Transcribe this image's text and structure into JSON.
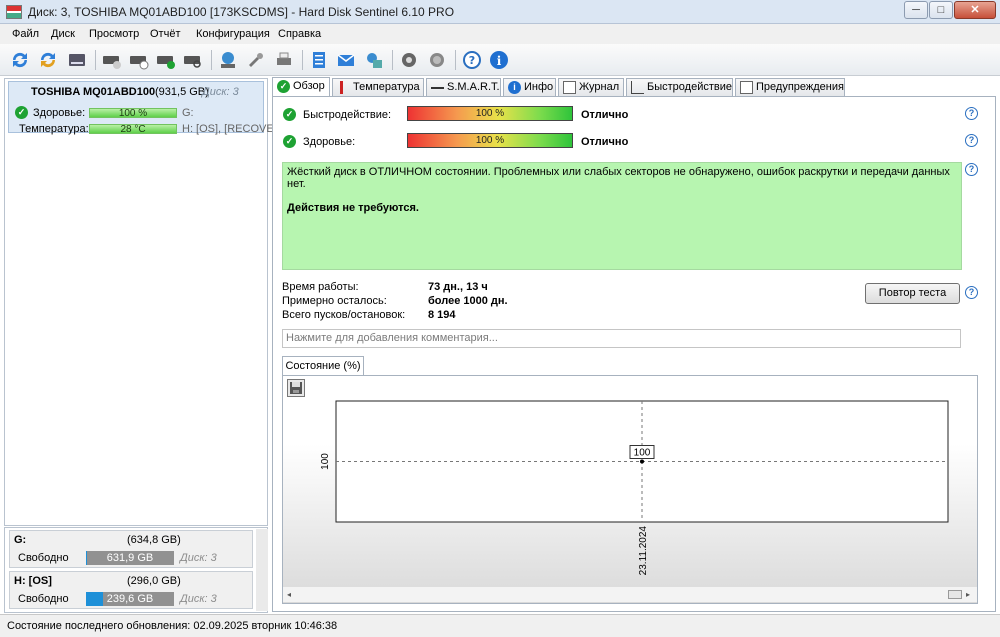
{
  "window": {
    "title": "Диск: 3, TOSHIBA MQ01ABD100 [173KSCDMS]  -  Hard Disk Sentinel 6.10 PRO",
    "minimize": "─",
    "maximize": "□",
    "close": "✕"
  },
  "menu": [
    "Файл",
    "Диск",
    "Просмотр",
    "Отчёт",
    "Конфигурация",
    "Справка"
  ],
  "toolbar_icons": [
    "refresh-icon",
    "refresh-all-icon",
    "disk-icon",
    "disk-info-icon",
    "disk-test-icon",
    "disk-ok-icon",
    "disk-search-icon",
    "network-icon",
    "tools-icon",
    "printer-icon",
    "report-icon",
    "mail-icon",
    "send-icon",
    "settings-icon",
    "sound-icon",
    "help-icon",
    "info-icon"
  ],
  "disk": {
    "name": "TOSHIBA MQ01ABD100",
    "size": "(931,5 GB)",
    "number": "Диск: 3",
    "health_label": "Здоровье:",
    "health_value": "100 %",
    "health_drive": "G:",
    "temp_label": "Температура:",
    "temp_value": "28 °C",
    "temp_drives": "H: [OS],  [RECOVER"
  },
  "partitions": [
    {
      "name": "G:",
      "size": "(634,8 GB)",
      "free_label": "Свободно",
      "free": "631,9 GB",
      "free_fraction": 0.995,
      "disk": "Диск: 3"
    },
    {
      "name": "H: [OS]",
      "size": "(296,0 GB)",
      "free_label": "Свободно",
      "free": "239,6 GB",
      "free_fraction": 0.81,
      "disk": "Диск: 3"
    }
  ],
  "tabs": [
    {
      "label": "Обзор",
      "icon": "check-icon"
    },
    {
      "label": "Температура",
      "icon": "thermometer-icon"
    },
    {
      "label": "S.M.A.R.T.",
      "icon": "dash-icon"
    },
    {
      "label": "Инфо",
      "icon": "info-icon"
    },
    {
      "label": "Журнал",
      "icon": "log-icon"
    },
    {
      "label": "Быстродействие",
      "icon": "chart-icon"
    },
    {
      "label": "Предупреждения",
      "icon": "warning-doc-icon"
    }
  ],
  "overview": {
    "performance_label": "Быстродействие:",
    "performance_value": "100 %",
    "performance_rating": "Отлично",
    "health_label": "Здоровье:",
    "health_value": "100 %",
    "health_rating": "Отлично",
    "message": "Жёсткий диск в ОТЛИЧНОМ состоянии. Проблемных или слабых секторов не обнаружено, ошибок раскрутки и передачи данных нет.",
    "action": "Действия не требуются.",
    "uptime_label": "Время работы:",
    "uptime_value": "73 дн., 13 ч",
    "remaining_label": "Примерно осталось:",
    "remaining_value": "более 1000 дн.",
    "starts_label": "Всего пусков/остановок:",
    "starts_value": "8 194",
    "retest_button": "Повтор теста",
    "comment_placeholder": "Нажмите для добавления комментария..."
  },
  "chart_tab": "Состояние (%)",
  "chart_data": {
    "type": "line",
    "x": [
      "23.11.2024"
    ],
    "values": [
      100
    ],
    "data_labels": [
      "100"
    ],
    "y_tick": "100",
    "grid": true
  },
  "status": "Состояние последнего обновления: 02.09.2025 вторник 10:46:38"
}
